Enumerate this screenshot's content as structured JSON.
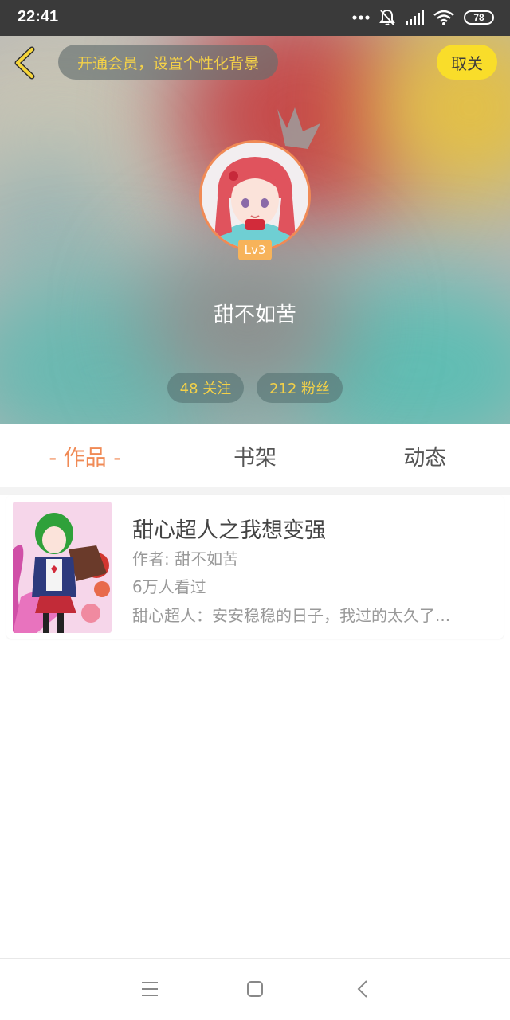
{
  "status_bar": {
    "time": "22:41",
    "battery": "78",
    "icons": [
      "more-dots-icon",
      "bell-off-icon",
      "signal-icon",
      "wifi-icon",
      "battery-icon"
    ]
  },
  "header": {
    "vip_prompt": "开通会员，设置个性化背景",
    "follow_button": "取关",
    "level_badge": "Lv3",
    "username": "甜不如苦",
    "stats": {
      "following": "48 关注",
      "fans": "212 粉丝"
    }
  },
  "tabs": [
    {
      "label": "- 作品 -",
      "active": true
    },
    {
      "label": "书架",
      "active": false
    },
    {
      "label": "动态",
      "active": false
    }
  ],
  "books": [
    {
      "title": "甜心超人之我想变强",
      "author": "作者: 甜不如苦",
      "views": "6万人看过",
      "description": "甜心超人：安安稳稳的日子，我过的太久了..."
    }
  ],
  "colors": {
    "accent": "#f08a55",
    "vip_text": "#f4d148",
    "follow_button_bg": "#f9dd2a"
  },
  "nav_bar": {
    "icons": [
      "menu-icon",
      "home-square-icon",
      "back-chevron-icon"
    ]
  }
}
